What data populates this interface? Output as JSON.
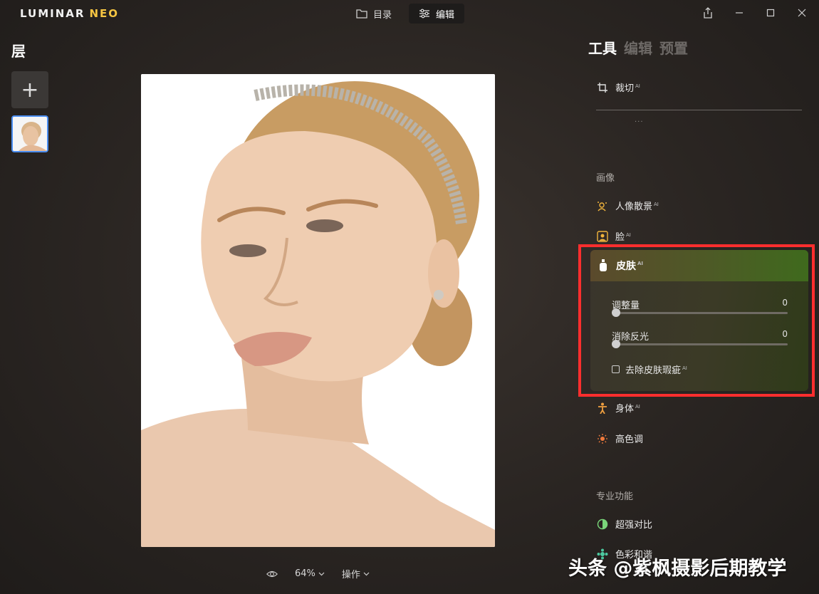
{
  "app": {
    "logo_main": "LUMINAR",
    "logo_accent": "NEO",
    "brand_accent_color": "#f5c542"
  },
  "topnav": {
    "tabs": [
      {
        "label": "目录",
        "icon": "folder-icon",
        "active": false
      },
      {
        "label": "编辑",
        "icon": "sliders-icon",
        "active": true
      }
    ]
  },
  "window_controls": [
    "share-icon",
    "minimize-icon",
    "maximize-icon",
    "close-icon"
  ],
  "layers": {
    "title": "层",
    "add_label": "+"
  },
  "bottombar": {
    "zoom": "64%",
    "actions_label": "操作"
  },
  "right_panel": {
    "tabs": [
      {
        "label": "工具",
        "active": true
      },
      {
        "label": "编辑",
        "active": false
      },
      {
        "label": "预置",
        "active": false
      }
    ],
    "tools_top": [
      {
        "label": "裁切",
        "ai": "AI",
        "icon": "crop-icon"
      }
    ],
    "more_dots": "···",
    "section_portrait": "画像",
    "portrait_tools": [
      {
        "label": "人像散景",
        "ai": "AI",
        "icon": "portrait-bokeh-icon"
      },
      {
        "label": "脸",
        "ai": "AI",
        "icon": "face-icon"
      }
    ],
    "skin": {
      "label": "皮肤",
      "ai": "AI",
      "icon": "skin-bottle-icon",
      "highlight_color": "#ff2e2e",
      "sliders": [
        {
          "label": "调整量",
          "value": "0",
          "level": 0
        },
        {
          "label": "消除反光",
          "value": "0",
          "level": 0
        }
      ],
      "checkbox_label": "去除皮肤瑕疵",
      "checkbox_ai": "AI",
      "checkbox_checked": false
    },
    "portrait_tools_after": [
      {
        "label": "身体",
        "ai": "AI",
        "icon": "body-icon"
      },
      {
        "label": "高色调",
        "ai": "",
        "icon": "high-key-icon"
      }
    ],
    "section_pro": "专业功能",
    "pro_tools": [
      {
        "label": "超强对比",
        "icon": "supercontrast-icon"
      },
      {
        "label": "色彩和谐",
        "icon": "color-harmony-icon"
      }
    ]
  },
  "watermark": "头条 @紫枫摄影后期教学"
}
